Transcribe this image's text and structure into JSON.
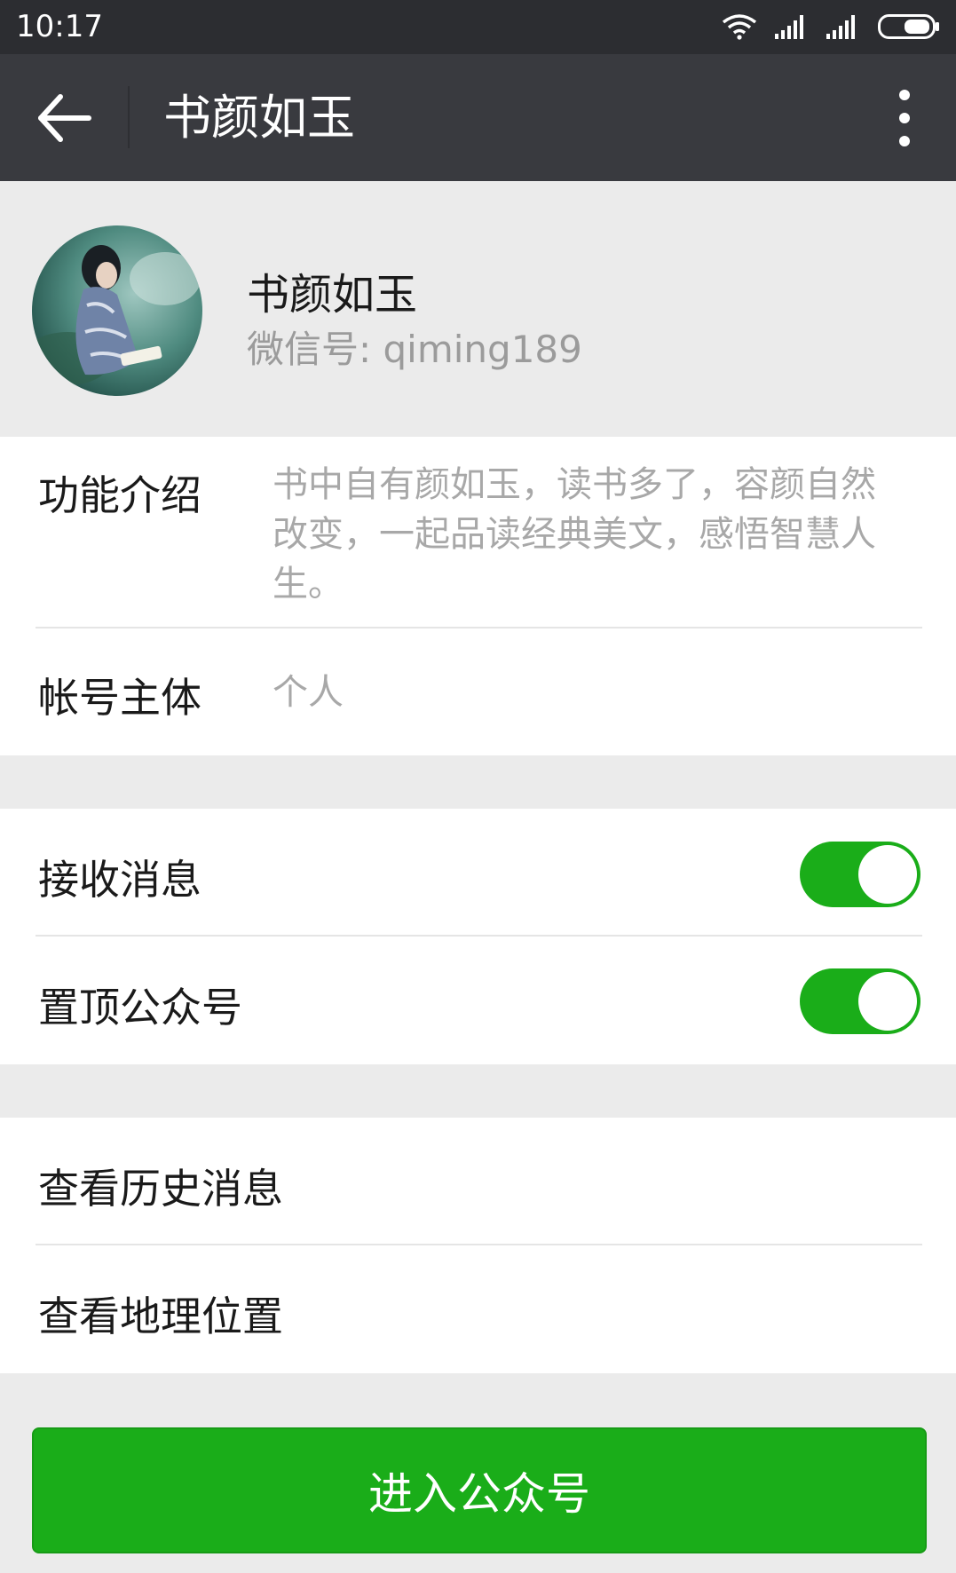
{
  "status_bar": {
    "time": "10:17",
    "icons": [
      "wifi-icon",
      "signal-icon",
      "signal-icon",
      "battery-icon"
    ]
  },
  "app_bar": {
    "title": "书颜如玉",
    "back_icon": "back-arrow-icon",
    "more_icon": "more-vertical-icon"
  },
  "profile": {
    "name": "书颜如玉",
    "wechat_id": "微信号: qiming189"
  },
  "info": {
    "intro_label": "功能介绍",
    "intro_value": "书中自有颜如玉，读书多了，容颜自然改变，一起品读经典美文，感悟智慧人生。",
    "entity_label": "帐号主体",
    "entity_value": "个人"
  },
  "settings": {
    "receive_label": "接收消息",
    "receive_on": true,
    "pin_label": "置顶公众号",
    "pin_on": true
  },
  "actions": {
    "history_label": "查看历史消息",
    "location_label": "查看地理位置"
  },
  "enter_button": "进入公众号",
  "colors": {
    "accent": "#1aad19",
    "appbar": "#393a3f",
    "statusbar": "#2c2d31",
    "background": "#ebebeb"
  }
}
